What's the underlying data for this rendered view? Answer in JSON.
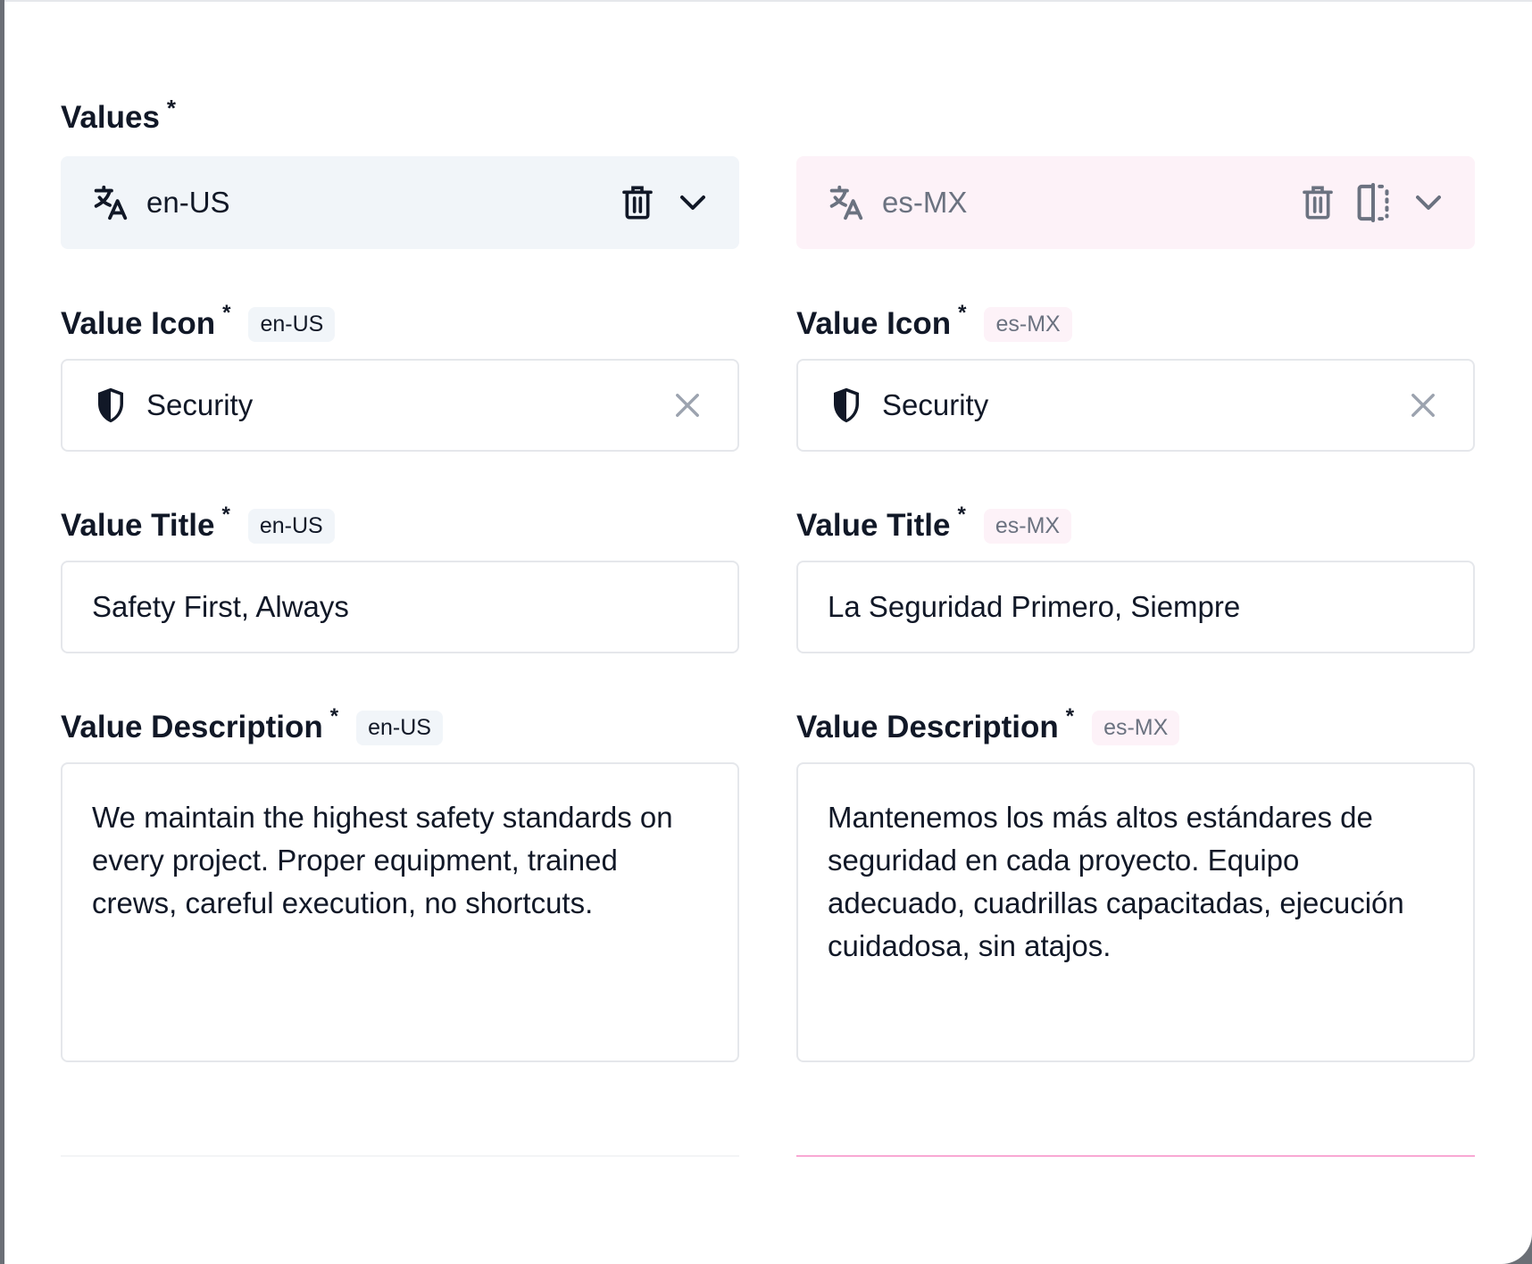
{
  "section": {
    "label": "Values",
    "required": "*"
  },
  "columns": [
    {
      "locale": "en-US",
      "header_actions": [
        "delete",
        "collapse"
      ],
      "fields": {
        "icon": {
          "label": "Value Icon",
          "required": "*",
          "badge": "en-US",
          "value": "Security"
        },
        "title": {
          "label": "Value Title",
          "required": "*",
          "badge": "en-US",
          "value": "Safety First, Always"
        },
        "description": {
          "label": "Value Description",
          "required": "*",
          "badge": "en-US",
          "value": "We maintain the highest safety standards on every project. Proper equipment, trained crews, careful execution, no shortcuts."
        }
      }
    },
    {
      "locale": "es-MX",
      "header_actions": [
        "delete",
        "split-view",
        "collapse"
      ],
      "fields": {
        "icon": {
          "label": "Value Icon",
          "required": "*",
          "badge": "es-MX",
          "value": "Security"
        },
        "title": {
          "label": "Value Title",
          "required": "*",
          "badge": "es-MX",
          "value": "La Seguridad Primero, Siempre"
        },
        "description": {
          "label": "Value Description",
          "required": "*",
          "badge": "es-MX",
          "value": "Mantenemos los más altos estándares de seguridad en cada proyecto. Equipo adecuado, cuadrillas capacitadas, ejecución cuidadosa, sin atajos."
        }
      }
    }
  ],
  "colors": {
    "en_header_bg": "#f1f5f9",
    "es_header_bg": "#fdf2f8",
    "es_accent_line": "#f9a8d4",
    "text_primary": "#111827",
    "text_muted": "#6b7280"
  },
  "icons": {
    "language": "translate-icon",
    "delete": "trash-icon",
    "split": "split-view-icon",
    "collapse": "chevron-down-icon",
    "field_icon": "shield-icon",
    "clear": "close-icon"
  }
}
